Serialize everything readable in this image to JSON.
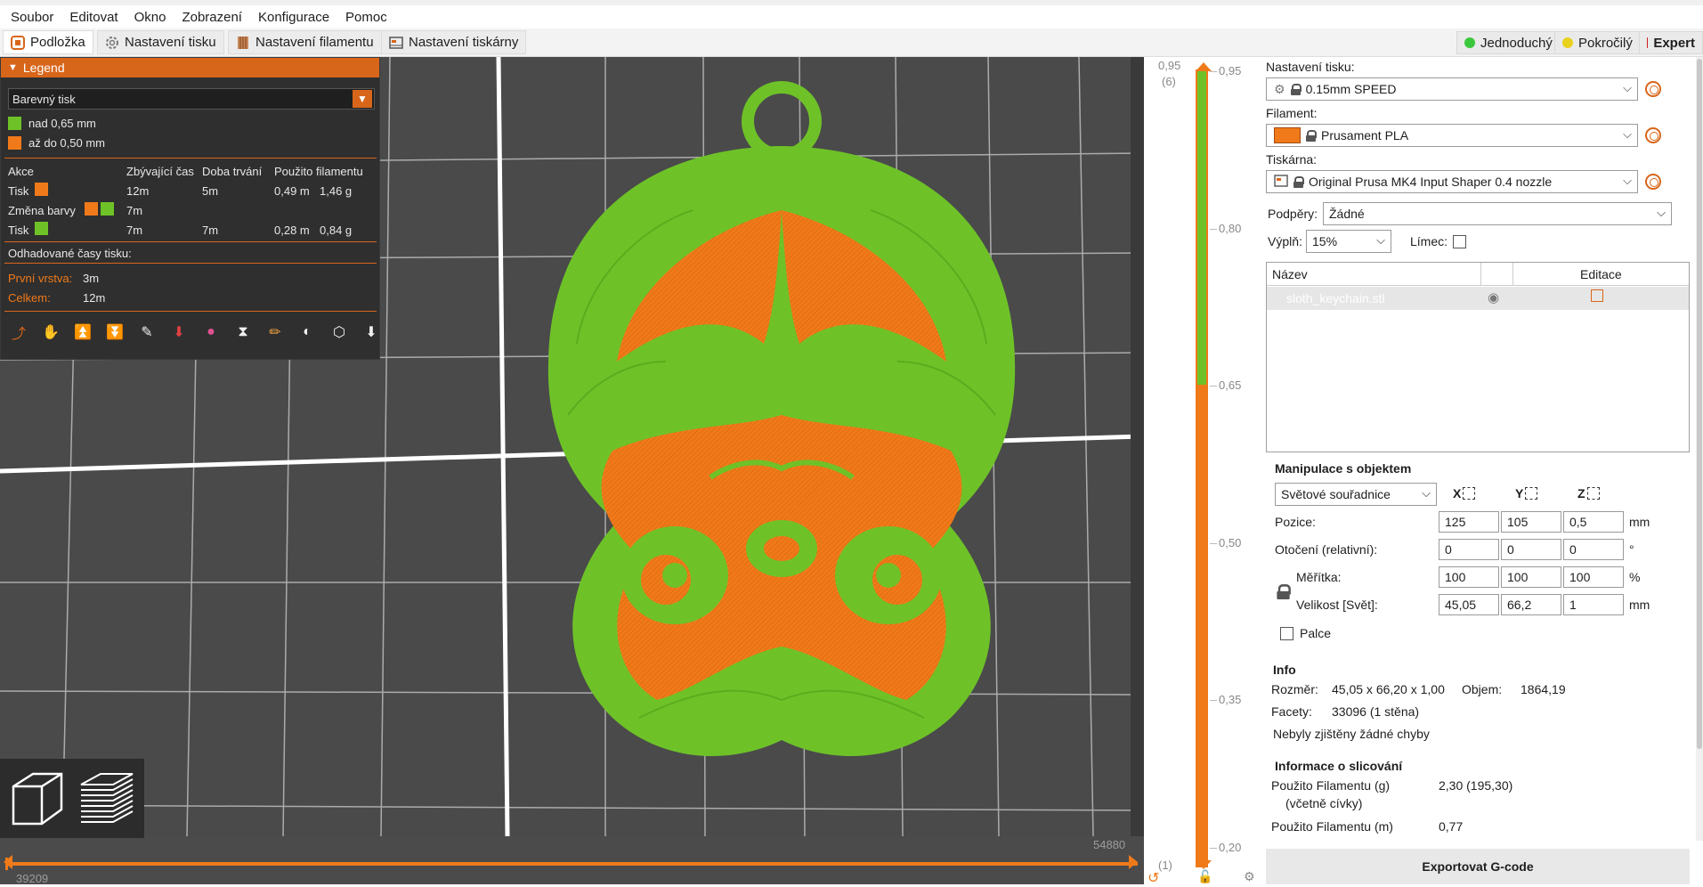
{
  "menu": [
    "Soubor",
    "Editovat",
    "Okno",
    "Zobrazení",
    "Konfigurace",
    "Pomoc"
  ],
  "tabs": {
    "plater": "Podložka",
    "print_settings": "Nastavení tisku",
    "filament_settings": "Nastavení filamentu",
    "printer_settings": "Nastavení tiskárny"
  },
  "modes": {
    "simple": "Jednoduchý",
    "advanced": "Pokročilý",
    "expert": "Expert"
  },
  "colors": {
    "accent": "#d8661a",
    "green": "#6ec228",
    "orange": "#f07a1a",
    "simple": "#3cc83c",
    "advanced": "#e8d21e",
    "expert": "#d01e1e"
  },
  "legend": {
    "title": "Legend",
    "view_type": "Barevný tisk",
    "items": [
      {
        "label": "nad 0,65 mm",
        "color": "#6ec228"
      },
      {
        "label": "až do 0,50 mm",
        "color": "#f07a1a"
      }
    ],
    "table_headers": [
      "Akce",
      "Zbývající čas",
      "Doba trvání",
      "Použito filamentu"
    ],
    "rows": [
      {
        "action": "Tisk",
        "remaining": "12m",
        "duration": "5m",
        "length": "0,49 m",
        "weight": "1,46 g"
      },
      {
        "action": "Změna barvy",
        "remaining": "7m",
        "duration": "",
        "length": "",
        "weight": ""
      },
      {
        "action": "Tisk",
        "remaining": "7m",
        "duration": "7m",
        "length": "0,28 m",
        "weight": "0,84 g"
      }
    ],
    "estimated_title": "Odhadované časy tisku:",
    "first_layer_label": "První vrstva:",
    "first_layer_value": "3m",
    "total_label": "Celkem:",
    "total_value": "12m"
  },
  "moves": {
    "start": "39209",
    "end": "54880"
  },
  "layers": {
    "top_value": "0,95",
    "top_index": "(6)",
    "bottom_value": "0,20",
    "bottom_index": "(1)",
    "ticks": [
      "0,95",
      "0,80",
      "0,65",
      "0,50",
      "0,35",
      "0,20"
    ]
  },
  "sidebar": {
    "print_settings_label": "Nastavení tisku:",
    "print_profile": "0.15mm SPEED",
    "filament_label": "Filament:",
    "filament_profile": "Prusament PLA",
    "filament_color": "#f07a1a",
    "printer_label": "Tiskárna:",
    "printer_profile": "Original Prusa MK4 Input Shaper 0.4 nozzle",
    "supports_label": "Podpěry:",
    "supports_value": "Žádné",
    "infill_label": "Výplň:",
    "infill_value": "15%",
    "brim_label": "Límec:",
    "list_name_header": "Název",
    "list_edit_header": "Editace",
    "object_name": "sloth_keychain.stl",
    "manip_title": "Manipulace s objektem",
    "coords_select": "Světové souřadnice",
    "axis_x": "X",
    "axis_y": "Y",
    "axis_z": "Z",
    "position_label": "Pozice:",
    "position": [
      "125",
      "105",
      "0,5"
    ],
    "position_unit": "mm",
    "rotation_label": "Otočení (relativní):",
    "rotation": [
      "0",
      "0",
      "0"
    ],
    "rotation_unit": "°",
    "scale_label": "Měřítka:",
    "scale": [
      "100",
      "100",
      "100"
    ],
    "scale_unit": "%",
    "size_label": "Velikost [Svět]:",
    "size": [
      "45,05",
      "66,2",
      "1"
    ],
    "size_unit": "mm",
    "inches_label": "Palce",
    "info_title": "Info",
    "size_info_label": "Rozměr:",
    "size_info_value": "45,05 x 66,20 x 1,00",
    "volume_label": "Objem:",
    "volume_value": "1864,19",
    "facets_label": "Facety:",
    "facets_value": "33096 (1 stěna)",
    "errors_text": "Nebyly zjištěny žádné chyby",
    "slice_title": "Informace o slicování",
    "used_g_label": "Použito Filamentu (g)",
    "used_g_sub": "(včetně cívky)",
    "used_g_value": "2,30 (195,30)",
    "used_m_label": "Použito Filamentu (m)",
    "used_m_value": "0,77",
    "export_label": "Exportovat G-code"
  }
}
